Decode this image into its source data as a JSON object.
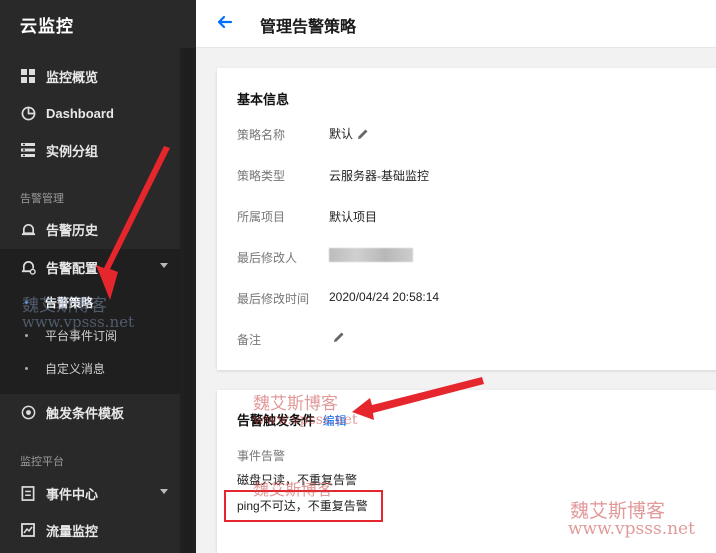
{
  "sidebar": {
    "brand": "云监控",
    "items": [
      {
        "label": "监控概览",
        "icon": "grid-icon"
      },
      {
        "label": "Dashboard",
        "icon": "clock-pie-icon"
      },
      {
        "label": "实例分组",
        "icon": "list-icon"
      }
    ],
    "group_alarm": "告警管理",
    "alarm_history": "告警历史",
    "alarm_config": "告警配置",
    "submenu": [
      {
        "label": "告警策略",
        "active": true
      },
      {
        "label": "平台事件订阅",
        "active": false
      },
      {
        "label": "自定义消息",
        "active": false
      }
    ],
    "trigger_template": "触发条件模板",
    "group_platform": "监控平台",
    "event_center": "事件中心",
    "traffic_monitor": "流量监控"
  },
  "header": {
    "title": "管理告警策略"
  },
  "basic_info": {
    "title": "基本信息",
    "rows": [
      {
        "label": "策略名称",
        "value": "默认"
      },
      {
        "label": "策略类型",
        "value": "云服务器-基础监控"
      },
      {
        "label": "所属项目",
        "value": "默认项目"
      },
      {
        "label": "最后修改人",
        "value": ""
      },
      {
        "label": "最后修改时间",
        "value": "2020/04/24 20:58:14"
      },
      {
        "label": "备注",
        "value": ""
      }
    ]
  },
  "trigger": {
    "title": "告警触发条件",
    "edit_label": "编辑",
    "event_label": "事件告警",
    "conditions": [
      "磁盘只读，不重复告警",
      "ping不可达，不重复告警"
    ]
  },
  "watermarks": {
    "name": "魏艾斯博客",
    "url": "www.vpsss.net"
  },
  "colors": {
    "accent": "#006eff",
    "sidebar_bg": "#292929",
    "highlight_red": "#e5262d"
  }
}
